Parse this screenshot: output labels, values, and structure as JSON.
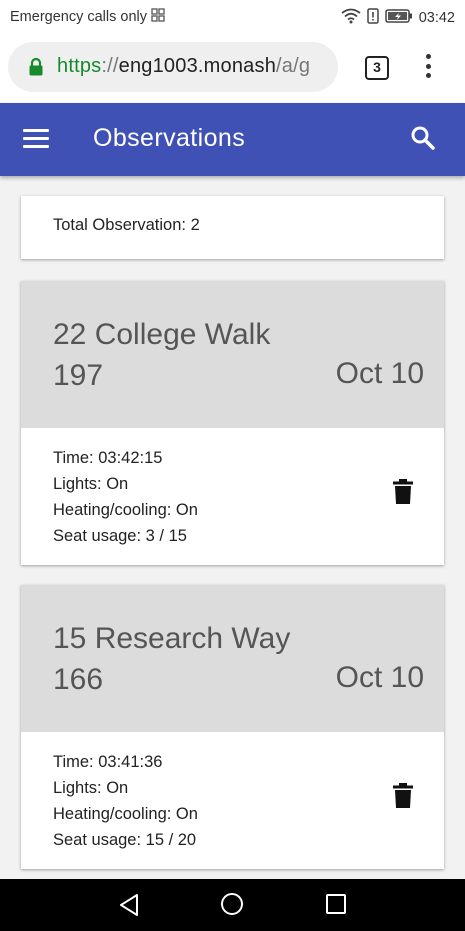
{
  "status_bar": {
    "carrier_text": "Emergency calls only",
    "time": "03:42",
    "icons": [
      "sim-icon",
      "wifi-icon",
      "alert-icon",
      "battery-icon"
    ]
  },
  "browser": {
    "url_scheme": "https",
    "url_separator": "://",
    "url_host": "eng1003.monash",
    "url_path": "/a/g",
    "tab_count": "3"
  },
  "app_bar": {
    "title": "Observations",
    "color": "#3f51b5"
  },
  "summary": {
    "total_text": "Total Observation: 2"
  },
  "observations": [
    {
      "address_line1": "22 College Walk",
      "address_line2": "197",
      "date": "Oct 10",
      "time": "Time: 03:42:15",
      "lights": "Lights: On",
      "heating": "Heating/cooling: On",
      "seats": "Seat usage: 3 / 15"
    },
    {
      "address_line1": "15 Research Way",
      "address_line2": "166",
      "date": "Oct 10",
      "time": "Time: 03:41:36",
      "lights": "Lights: On",
      "heating": "Heating/cooling: On",
      "seats": "Seat usage: 15 / 20"
    }
  ]
}
